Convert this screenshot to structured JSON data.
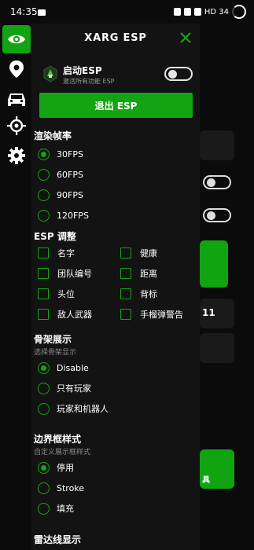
{
  "status_bar": {
    "time": "14:35",
    "signal_text": "HD 34",
    "icons": [
      "mail-icon",
      "alarm-icon",
      "wifi-icon",
      "cell-signal-icon",
      "battery-icon"
    ]
  },
  "rail": {
    "items": [
      {
        "icon": "eye-icon",
        "active": true
      },
      {
        "icon": "location-pin-icon",
        "active": false
      },
      {
        "icon": "car-icon",
        "active": false
      },
      {
        "icon": "crosshair-icon",
        "active": false
      },
      {
        "icon": "gear-icon",
        "active": false
      }
    ]
  },
  "panel": {
    "title": "XARG ESP",
    "close_icon": "close-icon",
    "esp": {
      "name": "启动ESP",
      "subtitle": "激活所有功能 ESP",
      "enabled": false
    },
    "exit_button": "退出 ESP",
    "fps": {
      "title": "渲染帧率",
      "options": [
        "30FPS",
        "60FPS",
        "90FPS",
        "120FPS"
      ],
      "selected": "30FPS"
    },
    "esp_adjust": {
      "title": "ESP 调整",
      "items": [
        "名字",
        "健康",
        "团队编号",
        "距离",
        "头位",
        "背标",
        "敌人武器",
        "手榴弹警告"
      ]
    },
    "skeleton": {
      "title": "骨架展示",
      "subtitle": "选择骨架显示",
      "options": [
        "Disable",
        "只有玩家",
        "玩家和机器人"
      ],
      "selected": "Disable"
    },
    "box_style": {
      "title": "边界框样式",
      "subtitle": "自定义展示框样式",
      "options": [
        "停用",
        "Stroke",
        "填充"
      ],
      "selected": "停用"
    },
    "radar": {
      "title": "雷达线显示"
    }
  },
  "background": {
    "number_text": "11",
    "label_text": "具"
  },
  "colors": {
    "accent": "#12a412",
    "panel_bg": "#131313",
    "page_bg": "#0b0b0b"
  }
}
